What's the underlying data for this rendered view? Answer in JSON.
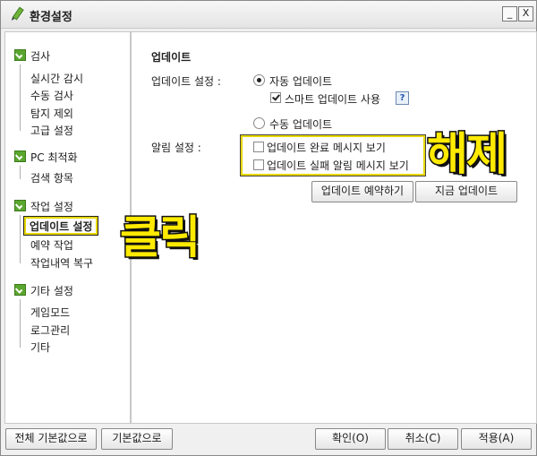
{
  "window": {
    "title": "환경설정",
    "minimize": "_",
    "close": "X"
  },
  "sidebar": {
    "categories": [
      {
        "label": "검사",
        "items": [
          "실시간 감시",
          "수동 검사",
          "탐지 제외",
          "고급 설정"
        ]
      },
      {
        "label": "PC 최적화",
        "items": [
          "검색 항목"
        ]
      },
      {
        "label": "작업 설정",
        "items": [
          "업데이트 설정",
          "예약 작업",
          "작업내역 복구"
        ]
      },
      {
        "label": "기타 설정",
        "items": [
          "게임모드",
          "로그관리",
          "기타"
        ]
      }
    ],
    "selected": "업데이트 설정"
  },
  "content": {
    "section_title": "업데이트",
    "update_setting_label": "업데이트 설정 :",
    "auto_update": "자동 업데이트",
    "smart_update": "스마트 업데이트 사용",
    "help_glyph": "?",
    "manual_update": "수동 업데이트",
    "alarm_label": "알림 설정 :",
    "alarm_complete": "업데이트 완료 메시지 보기",
    "alarm_fail": "업데이트 실패 알림 메시지 보기",
    "reserve_button": "업데이트 예약하기",
    "now_button": "지금 업데이트"
  },
  "state": {
    "auto_update_selected": true,
    "smart_update_checked": true,
    "alarm_complete_checked": false,
    "alarm_fail_checked": false
  },
  "annotations": {
    "release": "해제",
    "click": "클릭"
  },
  "footer": {
    "reset_all": "전체 기본값으로",
    "reset": "기본값으로",
    "ok": "확인(O)",
    "cancel": "취소(C)",
    "apply": "적용(A)"
  },
  "colors": {
    "highlight": "#e7d800",
    "category_icon": "#5aa62e",
    "annotation": "#ffea00"
  }
}
